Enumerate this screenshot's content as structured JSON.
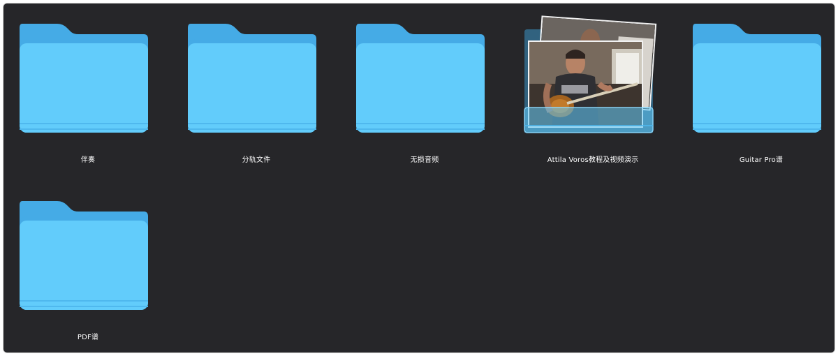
{
  "window": {
    "background": "#262629"
  },
  "colors": {
    "folder_front": "#62CCFB",
    "folder_back": "#45ABE6",
    "folder_stripe": "#4FB8EE"
  },
  "items": [
    {
      "label": "伴奏",
      "type": "folder",
      "icon": "folder-icon"
    },
    {
      "label": "分轨文件",
      "type": "folder",
      "icon": "folder-icon"
    },
    {
      "label": "无损音频",
      "type": "folder",
      "icon": "folder-icon"
    },
    {
      "label": "Attila Voros教程及视频演示",
      "type": "folder-with-preview",
      "icon": "folder-preview-icon"
    },
    {
      "label": "Guitar Pro谱",
      "type": "folder",
      "icon": "folder-icon"
    },
    {
      "label": "PDF谱",
      "type": "folder",
      "icon": "folder-icon"
    }
  ]
}
